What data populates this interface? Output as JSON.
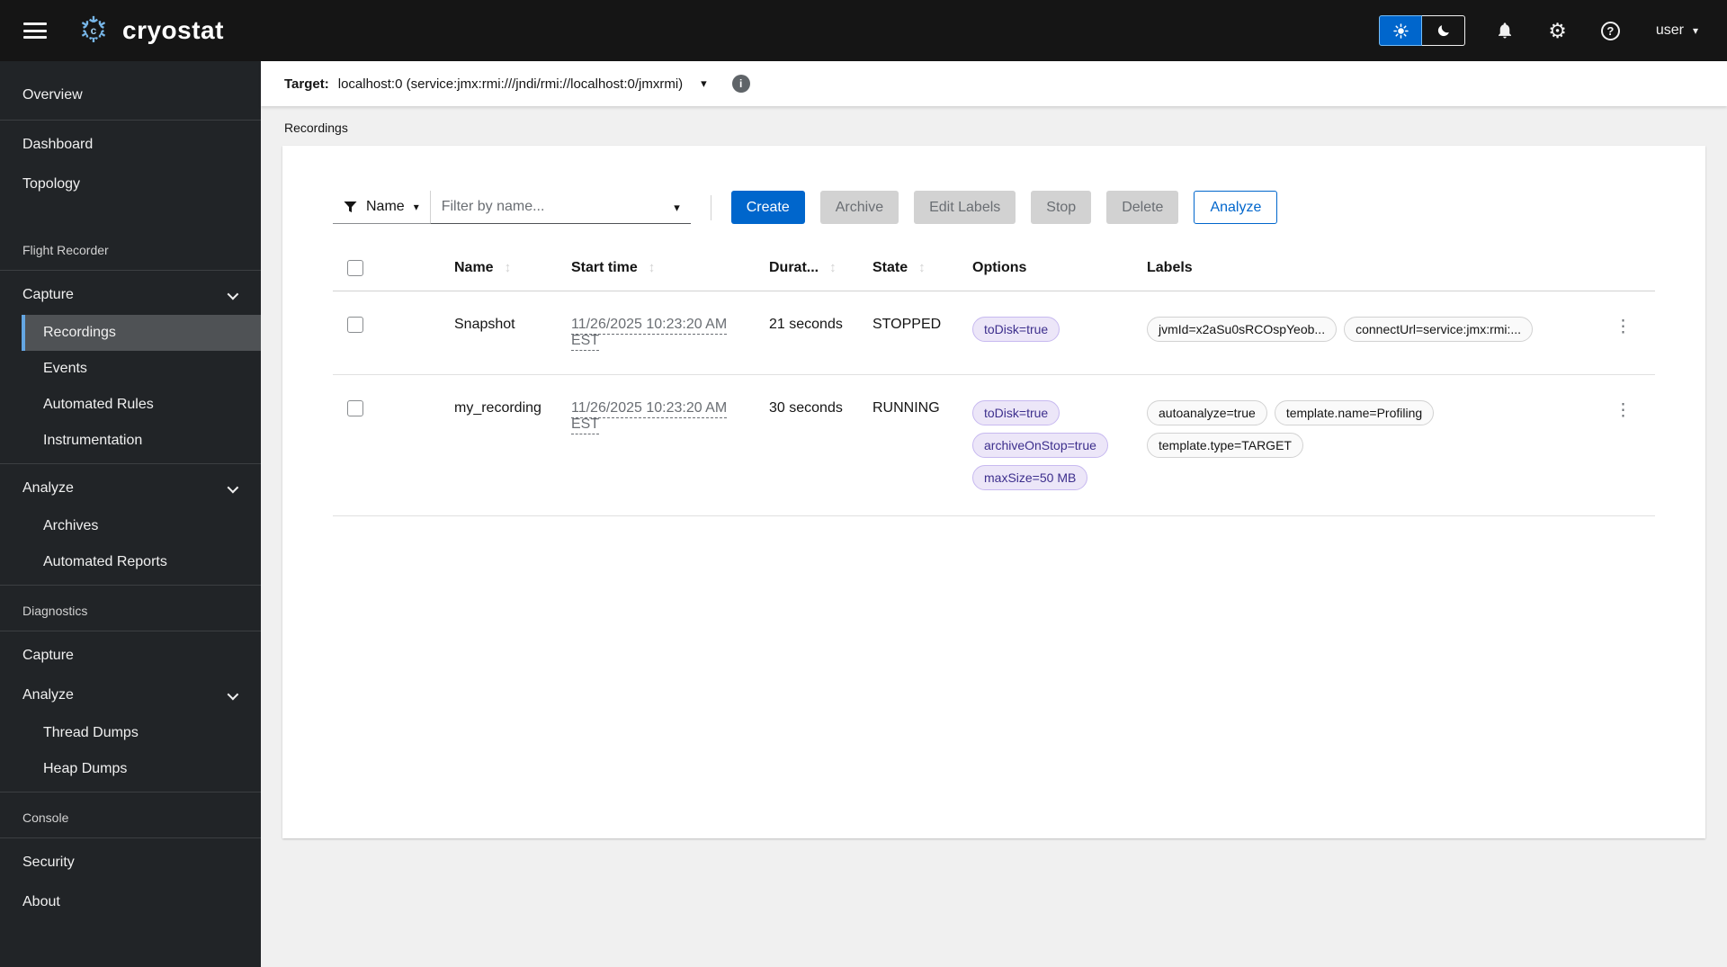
{
  "masthead": {
    "brand": "cryostat",
    "logo_glyph": "❄",
    "logo_letter": "c",
    "user_menu": {
      "label": "user"
    },
    "icons": [
      "hamburger-icon",
      "snowflake-logo",
      "sun-icon",
      "moon-icon",
      "bell-icon",
      "gear-icon",
      "help-icon",
      "caret-down-icon"
    ]
  },
  "colors": {
    "accent_blue": "#0066cc",
    "nav_current_border": "#64a6e3",
    "masthead_bg": "#151515",
    "sidebar_bg": "#212427",
    "purple_label_bg": "#ece6f8",
    "purple_label_text": "#3d2f8d"
  },
  "sidebar": {
    "entries": [
      {
        "type": "link",
        "id": "overview",
        "label": "Overview"
      },
      {
        "type": "divider"
      },
      {
        "type": "link",
        "id": "dashboard",
        "label": "Dashboard"
      },
      {
        "type": "link",
        "id": "topology",
        "label": "Topology"
      },
      {
        "type": "spacer"
      },
      {
        "type": "title",
        "id": "flight-recorder",
        "label": "Flight Recorder"
      },
      {
        "type": "divider"
      },
      {
        "type": "expandable",
        "id": "capture",
        "label": "Capture",
        "expanded": true,
        "children": [
          {
            "id": "recordings",
            "label": "Recordings",
            "current": true
          },
          {
            "id": "events",
            "label": "Events"
          },
          {
            "id": "automated-rules",
            "label": "Automated Rules"
          },
          {
            "id": "instrumentation",
            "label": "Instrumentation"
          }
        ]
      },
      {
        "type": "divider"
      },
      {
        "type": "expandable",
        "id": "analyze",
        "label": "Analyze",
        "expanded": true,
        "children": [
          {
            "id": "archives",
            "label": "Archives"
          },
          {
            "id": "automated-reports",
            "label": "Automated Reports"
          }
        ]
      },
      {
        "type": "divider"
      },
      {
        "type": "title",
        "id": "diagnostics",
        "label": "Diagnostics"
      },
      {
        "type": "divider"
      },
      {
        "type": "link",
        "id": "diagnostics-capture",
        "label": "Capture"
      },
      {
        "type": "expandable",
        "id": "diagnostics-analyze",
        "label": "Analyze",
        "expanded": true,
        "children": [
          {
            "id": "thread-dumps",
            "label": "Thread Dumps"
          },
          {
            "id": "heap-dumps",
            "label": "Heap Dumps"
          }
        ]
      },
      {
        "type": "divider"
      },
      {
        "type": "title",
        "id": "console",
        "label": "Console"
      },
      {
        "type": "divider"
      },
      {
        "type": "link",
        "id": "security",
        "label": "Security"
      },
      {
        "type": "link",
        "id": "about",
        "label": "About"
      }
    ]
  },
  "target_bar": {
    "label": "Target:",
    "value": "localhost:0 (service:jmx:rmi:///jndi/rmi://localhost:0/jmxrmi)"
  },
  "breadcrumb": {
    "label": "Recordings"
  },
  "toolbar": {
    "filter": {
      "attribute": "Name",
      "placeholder": "Filter by name..."
    },
    "buttons": [
      {
        "label": "Create",
        "variant": "primary"
      },
      {
        "label": "Archive",
        "variant": "disabled"
      },
      {
        "label": "Edit Labels",
        "variant": "disabled"
      },
      {
        "label": "Stop",
        "variant": "disabled"
      },
      {
        "label": "Delete",
        "variant": "disabled"
      },
      {
        "label": "Analyze",
        "variant": "secondary"
      }
    ]
  },
  "table": {
    "columns": [
      {
        "label": "Name",
        "sortable": true
      },
      {
        "label": "Start time",
        "sortable": true
      },
      {
        "label": "Durat...",
        "sortable": true
      },
      {
        "label": "State",
        "sortable": true
      },
      {
        "label": "Options",
        "sortable": false
      },
      {
        "label": "Labels",
        "sortable": false
      }
    ],
    "rows": [
      {
        "name": "Snapshot",
        "start_time": "11/26/2025 10:23:20 AM EST",
        "duration": "21 seconds",
        "state": "STOPPED",
        "options": [
          "toDisk=true"
        ],
        "labels": [
          "jvmId=x2aSu0sRCOspYeob...",
          "connectUrl=service:jmx:rmi:..."
        ]
      },
      {
        "name": "my_recording",
        "start_time": "11/26/2025 10:23:20 AM EST",
        "duration": "30 seconds",
        "state": "RUNNING",
        "options": [
          "toDisk=true",
          "archiveOnStop=true",
          "maxSize=50 MB"
        ],
        "labels": [
          "autoanalyze=true",
          "template.name=Profiling",
          "template.type=TARGET"
        ]
      }
    ]
  },
  "glyphs": {
    "kebab": "⋮",
    "sort": "↕",
    "caret_down": "▾",
    "gear": "⚙",
    "info": "i",
    "help": "?"
  }
}
